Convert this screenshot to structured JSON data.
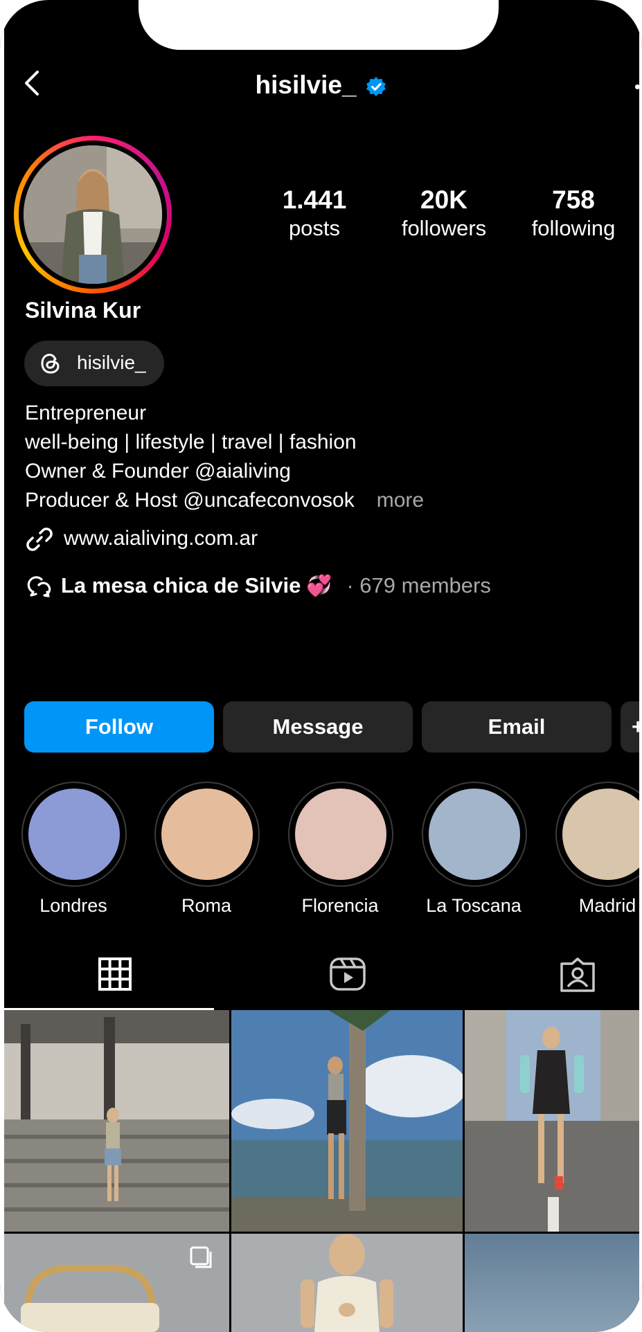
{
  "header": {
    "username": "hisilvie_",
    "verified": true,
    "back_icon": "chevron-left-icon",
    "verified_icon": "verified-badge-icon",
    "accent": "#0095f6"
  },
  "profile": {
    "name": "Silvina Kur",
    "stats": [
      {
        "value": "1.441",
        "label": "posts"
      },
      {
        "value": "20K",
        "label": "followers"
      },
      {
        "value": "758",
        "label": "following"
      }
    ],
    "threads_handle": "hisilvie_",
    "bio": [
      "Entrepreneur",
      "well-being | lifestyle | travel | fashion",
      "Owner & Founder @aialiving",
      "Producer & Host @uncafeconvosok"
    ],
    "more_label": "more",
    "link": "www.aialiving.com.ar",
    "channel": {
      "name": "La mesa chica de Silvie",
      "emoji": "💞",
      "separator": "·",
      "members": "679 members"
    }
  },
  "buttons": {
    "follow": "Follow",
    "message": "Message",
    "email": "Email",
    "more": "+"
  },
  "highlights": [
    {
      "label": "Londres",
      "color": "#8c9bd6"
    },
    {
      "label": "Roma",
      "color": "#e6bd9c"
    },
    {
      "label": "Florencia",
      "color": "#e3c3b8"
    },
    {
      "label": "La Toscana",
      "color": "#a3b5cb"
    },
    {
      "label": "Madrid",
      "color": "#d9c5ab"
    }
  ],
  "tabs": [
    {
      "name": "grid-icon",
      "active": true
    },
    {
      "name": "reels-icon",
      "active": false
    },
    {
      "name": "tagged-icon",
      "active": false
    }
  ],
  "posts": [
    {
      "name": "post-stairs-denim-shorts",
      "colors": [
        "#8e8b86",
        "#b9b5ae",
        "#6d6a66"
      ]
    },
    {
      "name": "post-beach-palm-tree",
      "colors": [
        "#6f9bc2",
        "#c9d7e3",
        "#5e7a66"
      ]
    },
    {
      "name": "post-street-black-dress",
      "colors": [
        "#9db4cc",
        "#7a7a76",
        "#4f4d4b"
      ]
    },
    {
      "name": "post-handbag",
      "colors": [
        "#9a9d9e",
        "#c4c2bd",
        "#e6dfcf"
      ]
    },
    {
      "name": "post-white-dress",
      "colors": [
        "#8d9196",
        "#b6b8ba",
        "#e8e2d4"
      ]
    },
    {
      "name": "post-sky",
      "colors": [
        "#5e7891",
        "#7e97ad",
        "#90a7ba"
      ]
    }
  ]
}
